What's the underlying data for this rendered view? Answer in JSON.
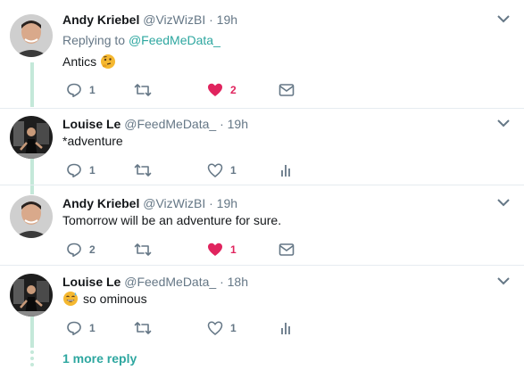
{
  "tweets": [
    {
      "name": "Andy Kriebel",
      "handle": "@VizWizBI",
      "dot": "·",
      "time": "19h",
      "replying_prefix": "Replying to",
      "replying_to": "@FeedMeData_",
      "text": "Antics",
      "emoji": "thinking-face-icon",
      "actions": {
        "reply": "1",
        "retweet": "",
        "like": "2",
        "liked": true,
        "extra": "mail-icon"
      }
    },
    {
      "name": "Louise Le",
      "handle": "@FeedMeData_",
      "dot": "·",
      "time": "19h",
      "text": "*adventure",
      "actions": {
        "reply": "1",
        "retweet": "",
        "like": "1",
        "liked": false,
        "extra": "analytics-icon"
      }
    },
    {
      "name": "Andy Kriebel",
      "handle": "@VizWizBI",
      "dot": "·",
      "time": "19h",
      "text": "Tomorrow will be an adventure for sure.",
      "actions": {
        "reply": "2",
        "retweet": "",
        "like": "1",
        "liked": true,
        "extra": "mail-icon"
      }
    },
    {
      "name": "Louise Le",
      "handle": "@FeedMeData_",
      "dot": "·",
      "time": "18h",
      "text": "so ominous",
      "emoji": "sweat-smile-icon",
      "actions": {
        "reply": "1",
        "retweet": "",
        "like": "1",
        "liked": false,
        "extra": "analytics-icon"
      }
    }
  ],
  "more_replies": "1 more reply",
  "colors": {
    "accent": "#2ea7a0",
    "like": "#e0245e",
    "muted": "#657786",
    "thread": "#c4e8d9"
  }
}
